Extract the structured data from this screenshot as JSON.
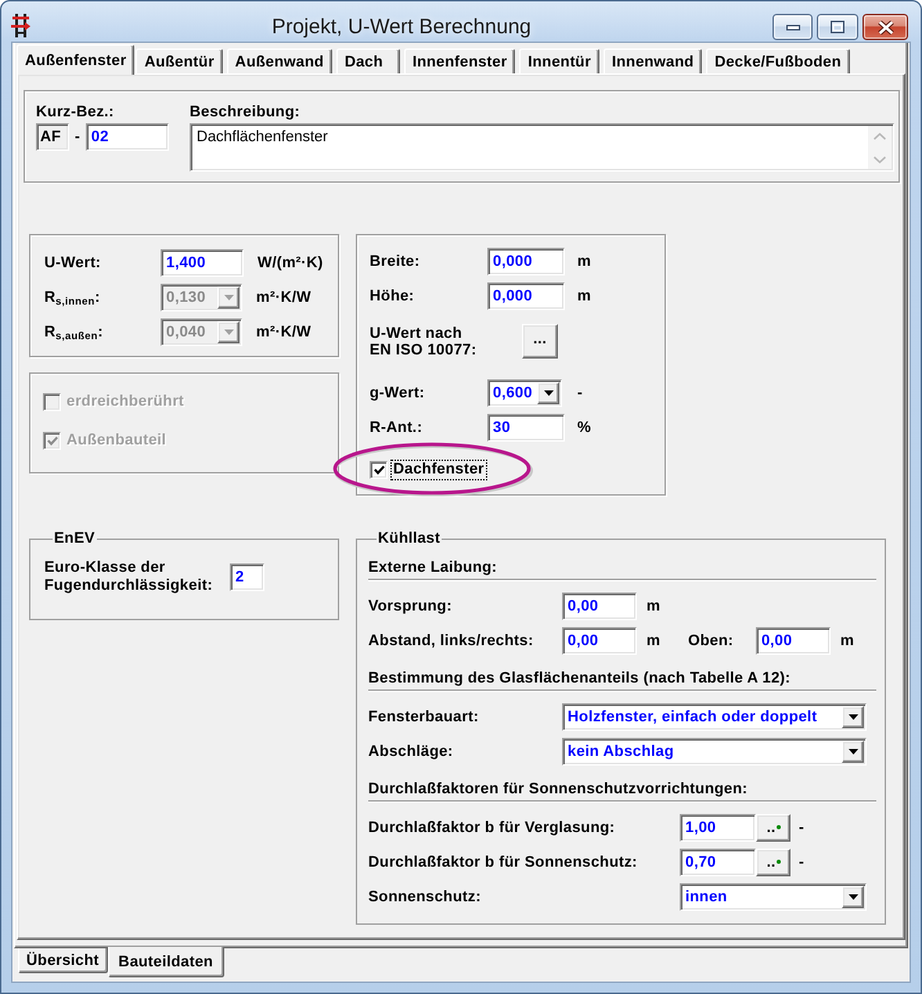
{
  "window": {
    "title": "Projekt, U-Wert Berechnung"
  },
  "tabs": [
    {
      "label": "Außenfenster",
      "selected": true
    },
    {
      "label": "Außentür",
      "selected": false
    },
    {
      "label": "Außenwand",
      "selected": false
    },
    {
      "label": "Dach",
      "selected": false
    },
    {
      "label": "Innenfenster",
      "selected": false
    },
    {
      "label": "Innentür",
      "selected": false
    },
    {
      "label": "Innenwand",
      "selected": false
    },
    {
      "label": "Decke/Fußboden",
      "selected": false
    }
  ],
  "identification": {
    "short_label": "Kurz-Bez.:",
    "prefix": "AF",
    "separator": "-",
    "short_value": "02",
    "description_label": "Beschreibung:",
    "description_value": "Dachflächenfenster"
  },
  "u_values": [
    {
      "kind": "input",
      "label": "U-Wert:",
      "value": "1,400",
      "unit": "W/(m²·K)",
      "disabled": false
    },
    {
      "kind": "combo",
      "label": "R$_{s,innen}$:",
      "value": "0,130",
      "unit": "m²·K/W",
      "disabled": true
    },
    {
      "kind": "combo",
      "label": "R$_{s,außen}$:",
      "value": "0,040",
      "unit": "m²·K/W",
      "disabled": true
    }
  ],
  "component_options": [
    {
      "label": "erdreichberührt",
      "checked": false,
      "disabled": true
    },
    {
      "label": "Außenbauteil",
      "checked": true,
      "disabled": true
    }
  ],
  "window_data": [
    {
      "kind": "input",
      "label": "Breite:",
      "value": "0,000",
      "unit": "m"
    },
    {
      "kind": "input",
      "label": "Höhe:",
      "value": "0,000",
      "unit": "m"
    },
    {
      "kind": "button",
      "label": "U-Wert nach\nEN ISO 10077:",
      "button": "..."
    },
    {
      "kind": "combo",
      "label": "g-Wert:",
      "value": "0,600",
      "unit": "-"
    },
    {
      "kind": "input",
      "label": "R-Ant.:",
      "value": "30",
      "unit": "%"
    },
    {
      "kind": "checkbox",
      "label": "Dachfenster",
      "checked": true,
      "focused": true,
      "highlighted": true
    }
  ],
  "enev": {
    "legend": "EnEV",
    "label": "Euro-Klasse der\nFugendurchlässigkeit:",
    "value": "2"
  },
  "cooling_load": {
    "legend": "Kühllast",
    "sections": [
      {
        "heading": "Externe Laibung:",
        "rows": [
          {
            "kind": "input",
            "label": "Vorsprung:",
            "value": "0,00",
            "unit": "m"
          },
          {
            "kind": "pair",
            "label": "Abstand, links/rechts:",
            "value": "0,00",
            "unit": "m",
            "second_label": "Oben:",
            "second_value": "0,00",
            "second_unit": "m"
          }
        ]
      },
      {
        "heading": "Bestimmung des Glasflächenanteils (nach Tabelle A 12):",
        "rows": [
          {
            "kind": "combo",
            "label": "Fensterbauart:",
            "value": "Holzfenster, einfach oder doppelt"
          },
          {
            "kind": "combo",
            "label": "Abschläge:",
            "value": "kein Abschlag"
          }
        ]
      },
      {
        "heading": "Durchlaßfaktoren für Sonnenschutzvorrichtungen:",
        "rows": [
          {
            "kind": "input_button",
            "label": "Durchlaßfaktor b für Verglasung:",
            "value": "1,00",
            "button": "..",
            "unit": "-"
          },
          {
            "kind": "input_button",
            "label": "Durchlaßfaktor b für Sonnenschutz:",
            "value": "0,70",
            "button": "..",
            "unit": "-"
          },
          {
            "kind": "combo",
            "label": "Sonnenschutz:",
            "value": "innen"
          }
        ]
      }
    ]
  },
  "bottom_tabs": [
    {
      "label": "Übersicht",
      "selected": false
    },
    {
      "label": "Bauteildaten",
      "selected": true
    }
  ]
}
